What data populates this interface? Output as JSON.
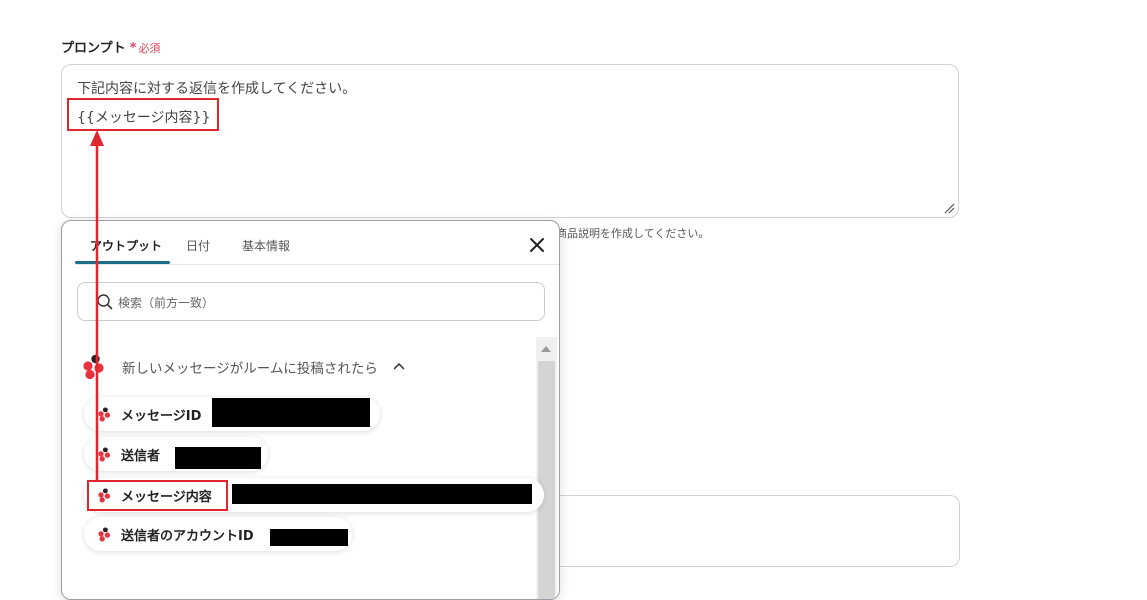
{
  "field": {
    "label": "プロンプト",
    "required_mark": "*",
    "required_text": "必須"
  },
  "prompt": {
    "line1": "下記内容に対する返信を作成してください。",
    "line2": "{{メッセージ内容}}"
  },
  "helper_fragment": "商品説明を作成してください。",
  "popup": {
    "tabs": [
      {
        "label": "アウトプット",
        "active": true
      },
      {
        "label": "日付",
        "active": false
      },
      {
        "label": "基本情報",
        "active": false
      }
    ],
    "search": {
      "placeholder": "検索（前方一致）",
      "value": ""
    },
    "group": {
      "title": "新しいメッセージがルームに投稿されたら",
      "expanded": true
    },
    "items": [
      {
        "label": "メッセージID",
        "highlighted": false
      },
      {
        "label": "送信者",
        "highlighted": false
      },
      {
        "label": "メッセージ内容",
        "highlighted": true
      },
      {
        "label": "送信者のアカウントID",
        "highlighted": false
      }
    ]
  },
  "icons": {
    "close": "close-icon",
    "search": "search-icon",
    "group": "chatwork-icon",
    "item": "chatwork-icon",
    "chevron": "chevron-up-icon"
  },
  "colors": {
    "required": "#e0455d",
    "tab_underline": "#1b6d8a",
    "annotation": "#e0262d",
    "brand_red": "#e8333f",
    "brand_dark": "#2b2023"
  }
}
